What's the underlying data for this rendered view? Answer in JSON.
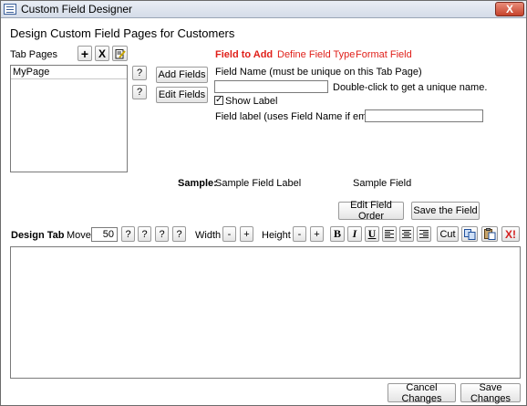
{
  "window": {
    "title": "Custom Field Designer",
    "close_glyph": "X"
  },
  "page_heading": "Design Custom Field Pages for Customers",
  "tab_pages": {
    "label": "Tab Pages",
    "add_glyph": "+",
    "delete_glyph": "X",
    "items": [
      "MyPage"
    ],
    "help_glyph": "?"
  },
  "actions": {
    "add_fields": "Add Fields",
    "edit_fields": "Edit Fields"
  },
  "links": {
    "field_to_add": "Field to Add",
    "define_field_type": "Define Field Type",
    "format_field": "Format Field"
  },
  "field_name": {
    "label": "Field Name (must be unique on this Tab Page)",
    "value": "",
    "hint": "Double-click to get a unique name."
  },
  "show_label": {
    "label": "Show Label",
    "checked": true,
    "check_glyph": "✓"
  },
  "field_label": {
    "label": "Field label (uses Field Name if empty)",
    "value": ""
  },
  "sample": {
    "label": "Sample:",
    "field_label": "Sample Field Label",
    "field": "Sample Field"
  },
  "buttons": {
    "edit_field_order": "Edit Field Order",
    "save_field": "Save the Field",
    "cancel_changes": "Cancel Changes",
    "save_changes": "Save Changes"
  },
  "design_toolbar": {
    "design_tab": "Design Tab",
    "move": "Move",
    "move_value": "50",
    "help_glyph": "?",
    "width": "Width",
    "height": "Height",
    "minus": "-",
    "plus": "+",
    "bold": "B",
    "italic": "I",
    "underline": "U",
    "cut": "Cut",
    "delete_all_glyph": "X!"
  },
  "colors": {
    "accent_red": "#e0201a",
    "title_bar": "#dde4ee",
    "delete_red": "#d42020"
  },
  "icons": [
    "add-icon",
    "delete-icon",
    "rename-icon",
    "align-left-icon",
    "align-center-icon",
    "align-right-icon",
    "copy-icon",
    "paste-icon",
    "delete-all-icon"
  ]
}
